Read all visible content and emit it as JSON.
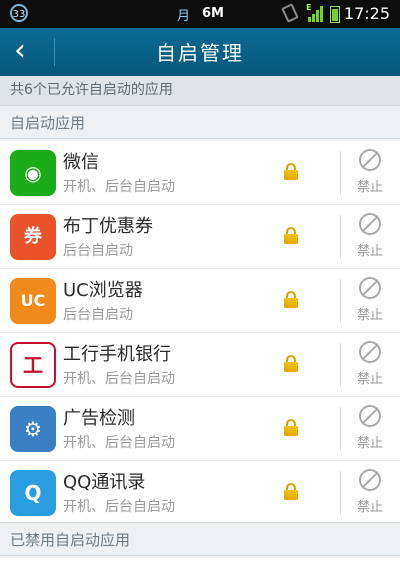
{
  "statusbar": {
    "notif_badge": "33",
    "moon_glyph": "月",
    "traffic": "6M",
    "network": "E",
    "time": "17:25"
  },
  "header": {
    "back_glyph": "‹",
    "title": "自启管理"
  },
  "summary": "共6个已允许自启动的应用",
  "sections": {
    "allowed_title": "自启动应用",
    "disabled_title": "已禁用自启动应用"
  },
  "apps": [
    {
      "name": "微信",
      "sub": "开机、后台自启动",
      "icon": "wechat-icon",
      "color": "#1aad19",
      "glyph": "◉"
    },
    {
      "name": "布丁优惠券",
      "sub": "后台自启动",
      "icon": "budding-coupon-icon",
      "color": "#e8532b",
      "glyph": "券"
    },
    {
      "name": "UC浏览器",
      "sub": "后台自启动",
      "icon": "uc-browser-icon",
      "color": "#f08a1c",
      "glyph": "UC"
    },
    {
      "name": "工行手机银行",
      "sub": "开机、后台自启动",
      "icon": "icbc-icon",
      "color": "#ffffff",
      "glyph": "工"
    },
    {
      "name": "广告检测",
      "sub": "开机、后台自启动",
      "icon": "ad-detect-icon",
      "color": "#3a7fc2",
      "glyph": "⚙"
    },
    {
      "name": "QQ通讯录",
      "sub": "开机、后台自启动",
      "icon": "qq-contacts-icon",
      "color": "#2a9de0",
      "glyph": "Q"
    }
  ],
  "toggle_label": "禁止",
  "colors": {
    "header": "#0b6a95",
    "lock": "#e5a600"
  }
}
